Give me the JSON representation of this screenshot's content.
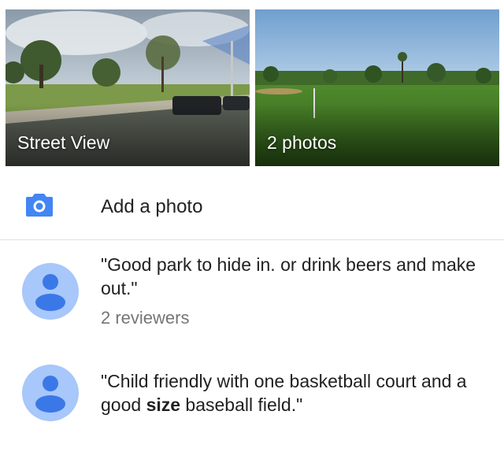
{
  "photo_tiles": {
    "street_view_label": "Street View",
    "photos_label": "2 photos"
  },
  "add_photo": {
    "label": "Add a photo",
    "icon": "camera-icon",
    "icon_color": "#4285F4"
  },
  "reviews": [
    {
      "quote": "\"Good park to hide in. or drink beers and make out.\"",
      "reviewers": "2 reviewers",
      "avatar_color": "#A8C7FA",
      "avatar_figure_color": "#3B78E7"
    },
    {
      "quote_before": "\"Child friendly with one basketball court and a good ",
      "quote_bold": "size",
      "quote_after": " baseball field.\"",
      "avatar_color": "#A8C7FA",
      "avatar_figure_color": "#3B78E7"
    }
  ]
}
